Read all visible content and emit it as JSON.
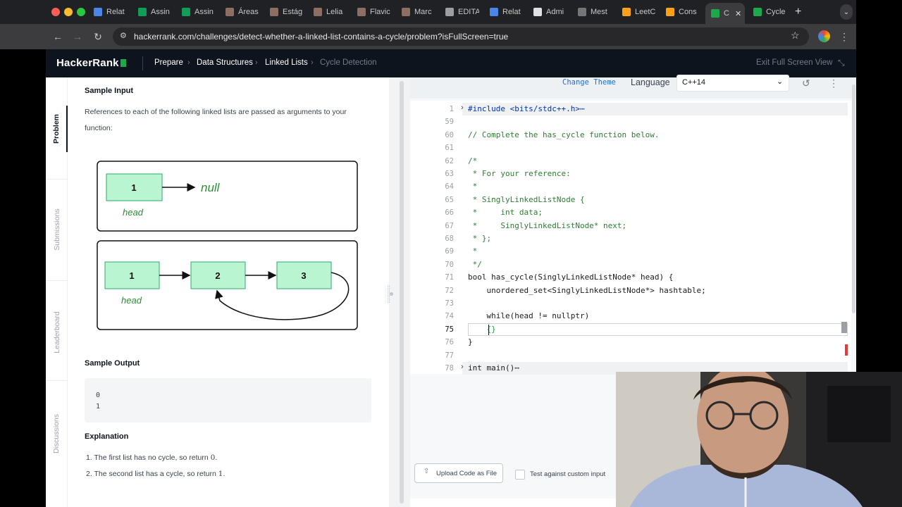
{
  "browser": {
    "tabs": [
      "Relat",
      "Assin",
      "Assin",
      "Áreas",
      "Estág",
      "Lelia",
      "Flavic",
      "Marc",
      "EDITA",
      "Relat",
      "Admi",
      "Mest",
      "LeetC",
      "Cons",
      "C",
      "Cycle"
    ],
    "url": "hackerrank.com/challenges/detect-whether-a-linked-list-contains-a-cycle/problem?isFullScreen=true"
  },
  "header": {
    "logo": "HackerRank",
    "breadcrumbs": [
      "Prepare",
      "Data Structures",
      "Linked Lists",
      "Cycle Detection"
    ],
    "exit_fullscreen": "Exit Full Screen View"
  },
  "sidetabs": [
    "Problem",
    "Submissions",
    "Leaderboard",
    "Discussions"
  ],
  "problem": {
    "sample_input_heading": "Sample Input",
    "sample_input_text_1": "References to each of the following linked lists are passed as arguments to your",
    "sample_input_text_2": "function:",
    "diagram": {
      "list1_node": "1",
      "list1_null": "null",
      "list1_head": "head",
      "list2_nodes": [
        "1",
        "2",
        "3"
      ],
      "list2_head": "head"
    },
    "sample_output_heading": "Sample Output",
    "sample_output_lines": [
      "0",
      "1"
    ],
    "explanation_heading": "Explanation",
    "explanation_items": [
      {
        "num": "1.",
        "text": "The first list has no cycle, so return",
        "value": "0",
        "end": "."
      },
      {
        "num": "2.",
        "text": "The second list has a cycle, so return",
        "value": "1",
        "end": "."
      }
    ]
  },
  "editor": {
    "change_theme": "Change Theme",
    "language_label": "Language",
    "language_value": "C++14",
    "lines": [
      {
        "n": "1",
        "text": "#include <bits/stdc++.h>⋯"
      },
      {
        "n": "59",
        "text": ""
      },
      {
        "n": "60",
        "text": "// Complete the has_cycle function below."
      },
      {
        "n": "61",
        "text": ""
      },
      {
        "n": "62",
        "text": "/*"
      },
      {
        "n": "63",
        "text": " * For your reference:"
      },
      {
        "n": "64",
        "text": " *"
      },
      {
        "n": "65",
        "text": " * SinglyLinkedListNode {"
      },
      {
        "n": "66",
        "text": " *     int data;"
      },
      {
        "n": "67",
        "text": " *     SinglyLinkedListNode* next;"
      },
      {
        "n": "68",
        "text": " * };"
      },
      {
        "n": "69",
        "text": " *"
      },
      {
        "n": "70",
        "text": " */"
      },
      {
        "n": "71",
        "text": "bool has_cycle(SinglyLinkedListNode* head) {"
      },
      {
        "n": "72",
        "text": "    unordered_set<SinglyLinkedListNode*> hashtable;"
      },
      {
        "n": "73",
        "text": ""
      },
      {
        "n": "74",
        "text": "    while(head != nullptr)"
      },
      {
        "n": "75",
        "text": "    {}"
      },
      {
        "n": "76",
        "text": "}"
      },
      {
        "n": "77",
        "text": ""
      },
      {
        "n": "78",
        "text": "int main()⋯"
      }
    ],
    "upload_button": "Upload Code as File",
    "custom_input_label": "Test against custom input"
  }
}
